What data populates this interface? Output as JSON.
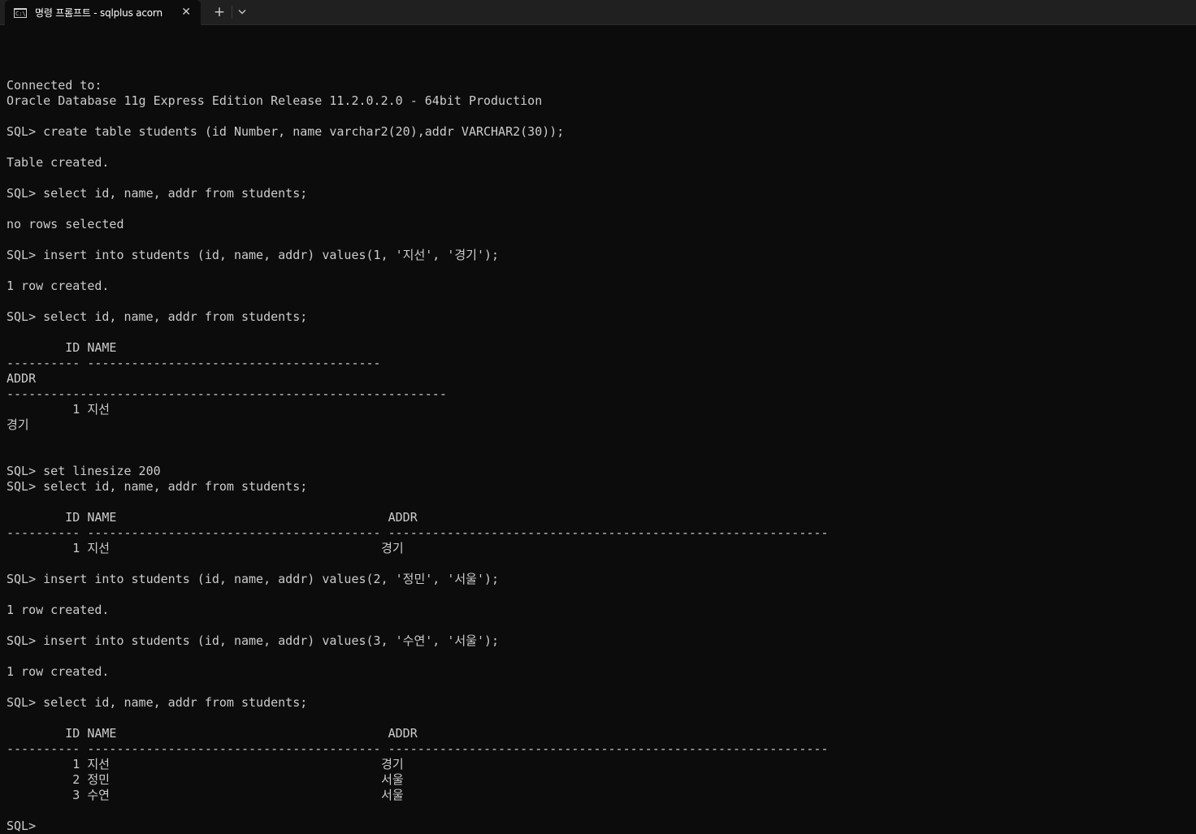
{
  "window": {
    "tab_title": "명령 프롬프트 - sqlplus  acorn",
    "tab_icon_glyph": "C:\\",
    "close_glyph": "✕",
    "new_tab_glyph": "+",
    "dropdown_icon": "chevron-down-icon"
  },
  "colors": {
    "background": "#0c0c0c",
    "text": "#cccccc",
    "titlebar": "#202020"
  },
  "console": {
    "lines": [
      "",
      "Connected to:",
      "Oracle Database 11g Express Edition Release 11.2.0.2.0 - 64bit Production",
      "",
      "SQL> create table students (id Number, name varchar2(20),addr VARCHAR2(30));",
      "",
      "Table created.",
      "",
      "SQL> select id, name, addr from students;",
      "",
      "no rows selected",
      "",
      "SQL> insert into students (id, name, addr) values(1, '지선', '경기');",
      "",
      "1 row created.",
      "",
      "SQL> select id, name, addr from students;",
      "",
      "        ID NAME",
      "---------- ----------------------------------------",
      "ADDR",
      "------------------------------------------------------------",
      "         1 지선",
      "경기",
      "",
      "",
      "SQL> set linesize 200",
      "SQL> select id, name, addr from students;",
      "",
      "        ID NAME                                     ADDR",
      "---------- ---------------------------------------- ------------------------------------------------------------",
      "         1 지선                                     경기",
      "",
      "SQL> insert into students (id, name, addr) values(2, '정민', '서울');",
      "",
      "1 row created.",
      "",
      "SQL> insert into students (id, name, addr) values(3, '수연', '서울');",
      "",
      "1 row created.",
      "",
      "SQL> select id, name, addr from students;",
      "",
      "        ID NAME                                     ADDR",
      "---------- ---------------------------------------- ------------------------------------------------------------",
      "         1 지선                                     경기",
      "         2 정민                                     서울",
      "         3 수연                                     서울",
      "",
      "SQL> "
    ]
  }
}
